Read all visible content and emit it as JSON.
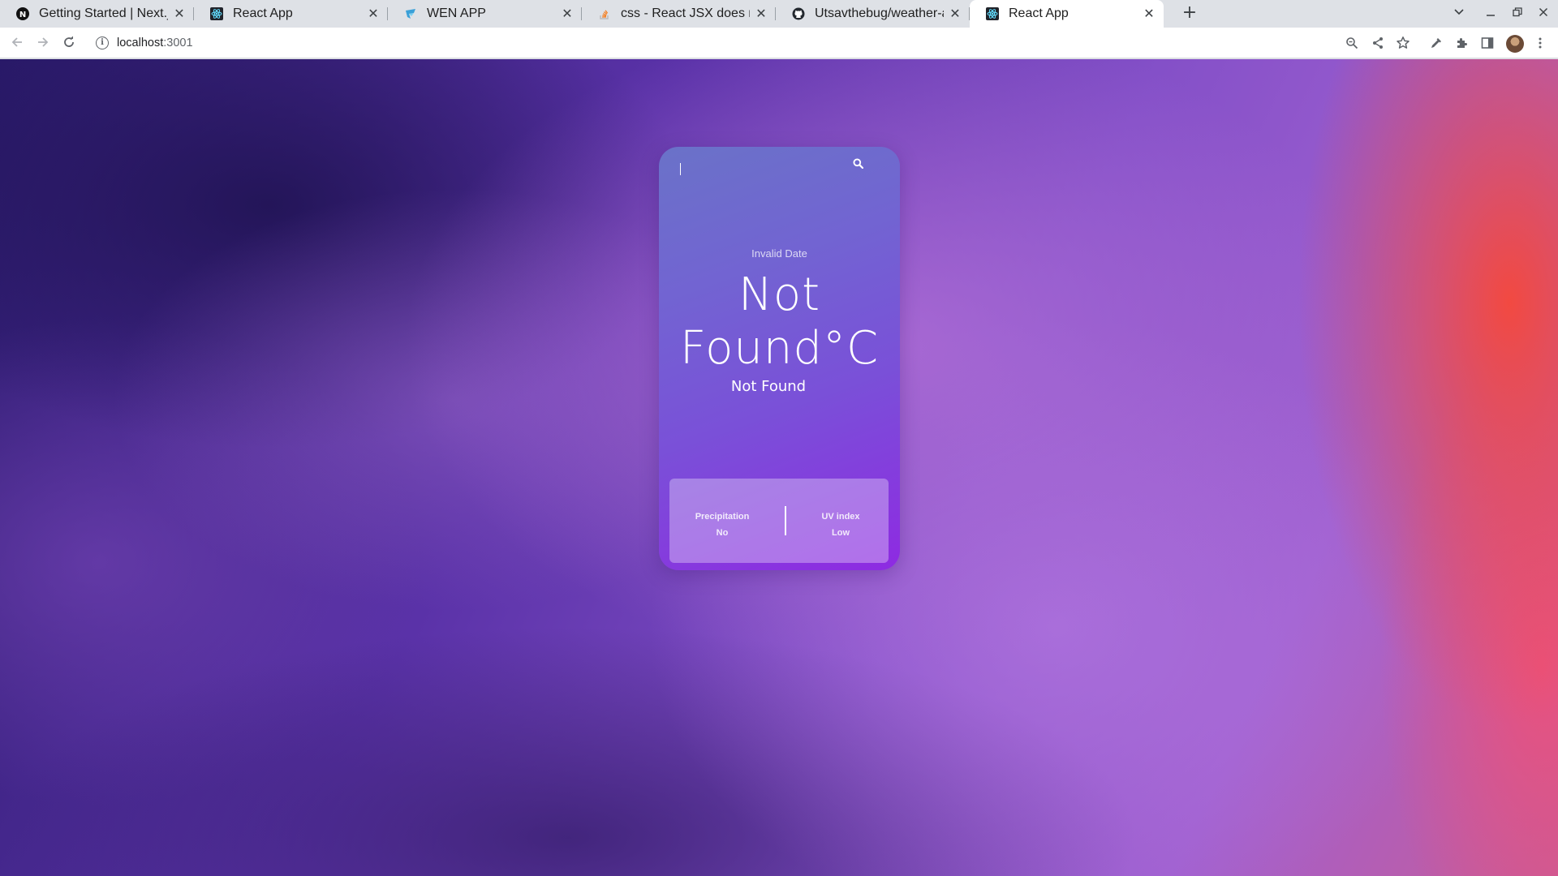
{
  "browser": {
    "tabs": [
      {
        "title": "Getting Started | Next.js",
        "icon": "nextjs-icon",
        "active": false
      },
      {
        "title": "React App",
        "icon": "react-icon",
        "active": false
      },
      {
        "title": "WEN APP",
        "icon": "app-icon",
        "active": false
      },
      {
        "title": "css - React JSX does not id",
        "icon": "stackoverflow-icon",
        "active": false
      },
      {
        "title": "Utsavthebug/weather-ap",
        "icon": "github-icon",
        "active": false
      },
      {
        "title": "React App",
        "icon": "react-icon",
        "active": true
      }
    ],
    "url_host": "localhost",
    "url_port": ":3001"
  },
  "weather": {
    "search_value": "",
    "date": "Invalid Date",
    "temperature": "Not Found°C",
    "condition": "Not Found",
    "precipitation_label": "Precipitation",
    "precipitation_value": "No",
    "uv_label": "UV index",
    "uv_value": "Low"
  }
}
